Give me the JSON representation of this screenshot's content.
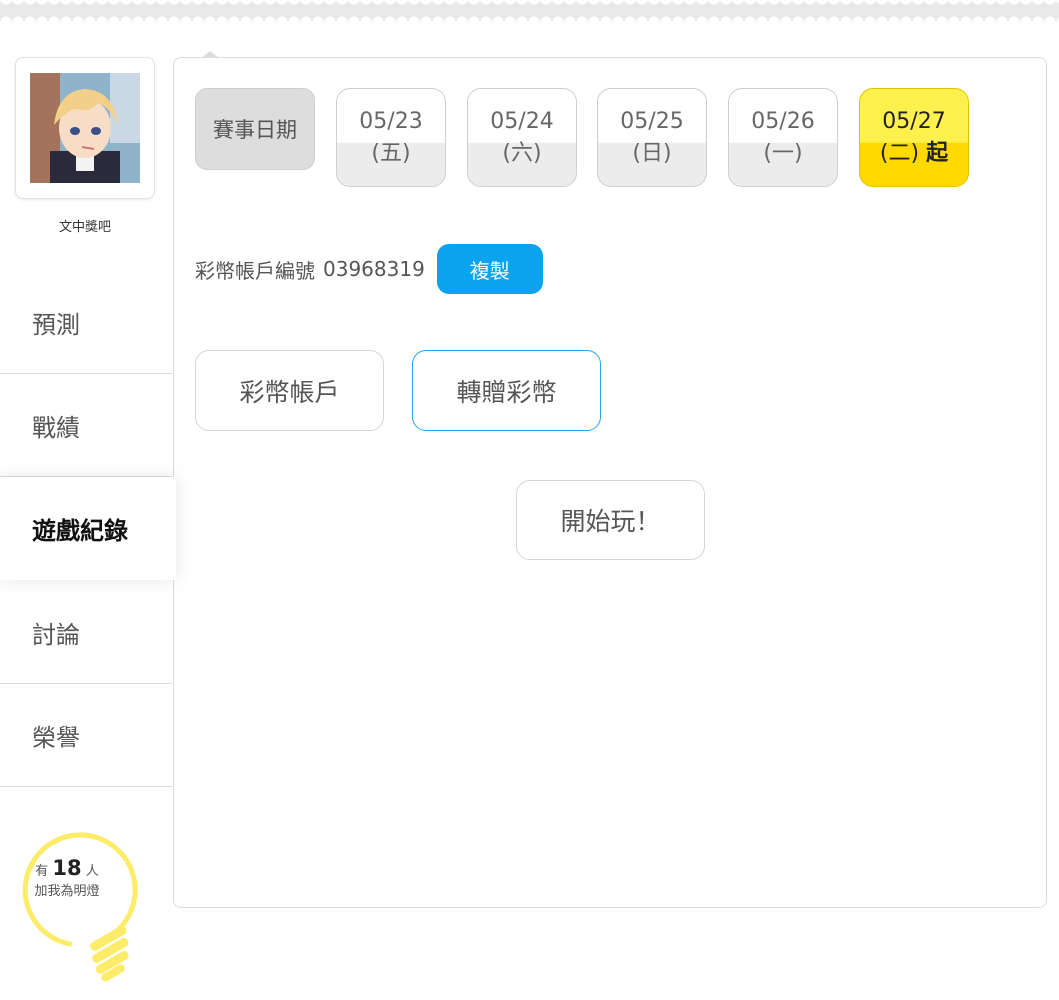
{
  "sidebar": {
    "username": "文中獎吧",
    "nav": [
      {
        "label": "預測"
      },
      {
        "label": "戰績"
      },
      {
        "label": "遊戲紀錄"
      },
      {
        "label": "討論"
      },
      {
        "label": "榮譽"
      }
    ],
    "bulb": {
      "prefix": "有",
      "count": "18",
      "suffix": "人",
      "caption": "加我為明燈"
    }
  },
  "main": {
    "date_label": "賽事日期",
    "dates": [
      {
        "date": "05/23",
        "weekday": "(五)",
        "extra": ""
      },
      {
        "date": "05/24",
        "weekday": "(六)",
        "extra": ""
      },
      {
        "date": "05/25",
        "weekday": "(日)",
        "extra": ""
      },
      {
        "date": "05/26",
        "weekday": "(一)",
        "extra": ""
      },
      {
        "date": "05/27",
        "weekday": "(二)",
        "extra": "起"
      }
    ],
    "account_label": "彩幣帳戶編號",
    "account_number": "03968319",
    "copy_label": "複製",
    "tabs": [
      {
        "label": "彩幣帳戶"
      },
      {
        "label": "轉贈彩幣"
      }
    ],
    "play_label": "開始玩！"
  },
  "colors": {
    "accent_blue": "#0aa3ee",
    "selected_yellow": "#fff14d",
    "bulb_yellow": "#fdeb6a"
  }
}
